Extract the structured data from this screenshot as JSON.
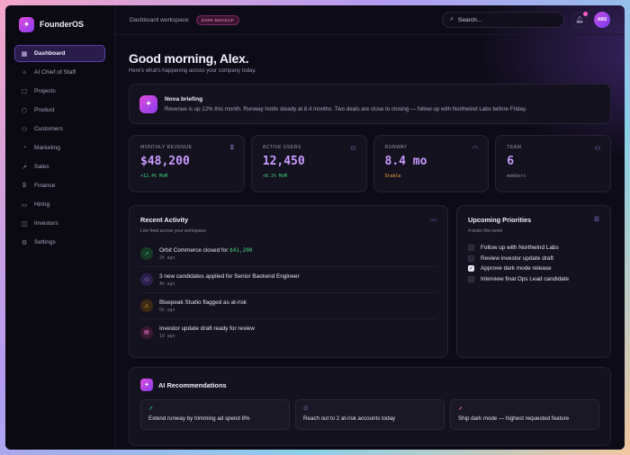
{
  "brand": {
    "name": "FounderOS",
    "logo_icon": "sparkle-icon"
  },
  "sidebar": {
    "items": [
      {
        "label": "Dashboard",
        "icon": "grid-icon",
        "active": true
      },
      {
        "label": "AI Chief of Staff",
        "icon": "sparkle-icon"
      },
      {
        "label": "Projects",
        "icon": "folder-icon"
      },
      {
        "label": "Product",
        "icon": "cube-icon"
      },
      {
        "label": "Customers",
        "icon": "users-icon"
      },
      {
        "label": "Marketing",
        "icon": "megaphone-icon"
      },
      {
        "label": "Sales",
        "icon": "trend-icon"
      },
      {
        "label": "Finance",
        "icon": "dollar-icon"
      },
      {
        "label": "Hiring",
        "icon": "briefcase-icon"
      },
      {
        "label": "Investors",
        "icon": "investor-icon"
      },
      {
        "label": "Settings",
        "icon": "gear-icon"
      }
    ]
  },
  "topbar": {
    "workspace_title": "Dashboard workspace",
    "badge": "DARK MOCKUP",
    "search_placeholder": "Search...",
    "avatar_initials": "ABS"
  },
  "greeting": {
    "title": "Good morning, Alex.",
    "subtitle": "Here's what's happening across your company today."
  },
  "briefing": {
    "title": "Nova briefing",
    "text": "Revenue is up 12% this month. Runway holds steady at 8.4 months. Two deals are close to closing — follow up with Northwind Labs before Friday."
  },
  "stats": [
    {
      "label": "MONTHLY REVENUE",
      "value": "$48,200",
      "delta": "+12.4% MoM",
      "icon": "dollar-icon",
      "tone": "green"
    },
    {
      "label": "ACTIVE USERS",
      "value": "12,450",
      "delta": "+8.1% MoM",
      "icon": "users-icon",
      "tone": "green"
    },
    {
      "label": "RUNWAY",
      "value": "8.4 mo",
      "delta": "Stable",
      "icon": "gauge-icon",
      "tone": "amber"
    },
    {
      "label": "TEAM",
      "value": "6",
      "delta": "members",
      "icon": "add-user-icon",
      "tone": "muted"
    }
  ],
  "activity": {
    "title": "Recent Activity",
    "subtitle": "Live feed across your workspace",
    "items": [
      {
        "text": "Orbit Commerce closed for ",
        "highlight": "$41,200",
        "time": "2h ago",
        "icon": "trend-icon",
        "tone": "green"
      },
      {
        "text": "3 new candidates applied for Senior Backend Engineer",
        "highlight": "",
        "time": "4h ago",
        "icon": "users-icon",
        "tone": "purple"
      },
      {
        "text": "Bluepeak Studio flagged as at-risk",
        "highlight": "",
        "time": "6h ago",
        "icon": "warning-icon",
        "tone": "amber"
      },
      {
        "text": "Investor update draft ready for review",
        "highlight": "",
        "time": "1d ago",
        "icon": "document-icon",
        "tone": "pink"
      }
    ]
  },
  "priorities": {
    "title": "Upcoming Priorities",
    "subtitle": "4 tasks this week",
    "items": [
      {
        "label": "Follow up with Northwind Labs",
        "checked": false
      },
      {
        "label": "Review investor update draft",
        "checked": false
      },
      {
        "label": "Approve dark mode release",
        "checked": true
      },
      {
        "label": "Interview final Ops Lead candidate",
        "checked": false
      }
    ]
  },
  "recommendations": {
    "title": "AI Recommendations",
    "items": [
      {
        "text": "Extend runway by trimming ad spend 8%",
        "icon": "trend-icon"
      },
      {
        "text": "Reach out to 2 at-risk accounts today",
        "icon": "users-icon"
      },
      {
        "text": "Ship dark mode — highest requested feature",
        "icon": "rocket-icon"
      }
    ]
  }
}
